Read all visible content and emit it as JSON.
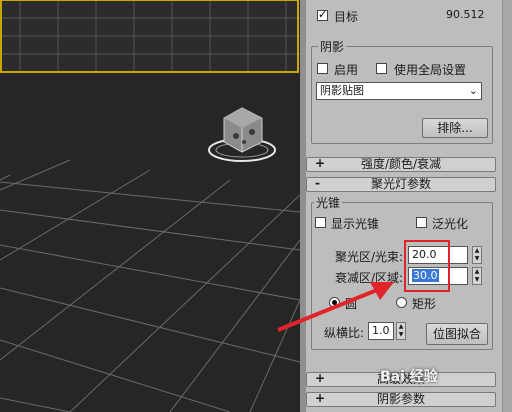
{
  "target": {
    "label": "目标",
    "checked": true,
    "value": "90.512"
  },
  "shadows": {
    "title": "阴影",
    "enable_label": "启用",
    "enable_checked": false,
    "global_label": "使用全局设置",
    "global_checked": false,
    "type_selected": "阴影贴图",
    "exclude_label": "排除..."
  },
  "rollouts": {
    "intensity": {
      "sign": "+",
      "title": "强度/颜色/衰减"
    },
    "spotlight": {
      "sign": "-",
      "title": "聚光灯参数"
    },
    "advanced": {
      "sign": "+",
      "title": "高级效果"
    },
    "shadow_params": {
      "sign": "+",
      "title": "阴影参数"
    }
  },
  "cone": {
    "title": "光锥",
    "show_cone_label": "显示光锥",
    "show_cone_checked": false,
    "overshoot_label": "泛光化",
    "overshoot_checked": false,
    "hotspot_label": "聚光区/光束:",
    "hotspot_value": "20.0",
    "falloff_label": "衰减区/区域:",
    "falloff_value": "30.0",
    "circle_label": "圆",
    "circle_selected": true,
    "rect_label": "矩形",
    "rect_selected": false,
    "aspect_label": "纵横比:",
    "aspect_value": "1.0",
    "bitmap_fit_label": "位图拟合"
  },
  "watermark": "Bai 经验",
  "colors": {
    "annotation": "#e0242a",
    "viewport_border": "#c8a800"
  }
}
